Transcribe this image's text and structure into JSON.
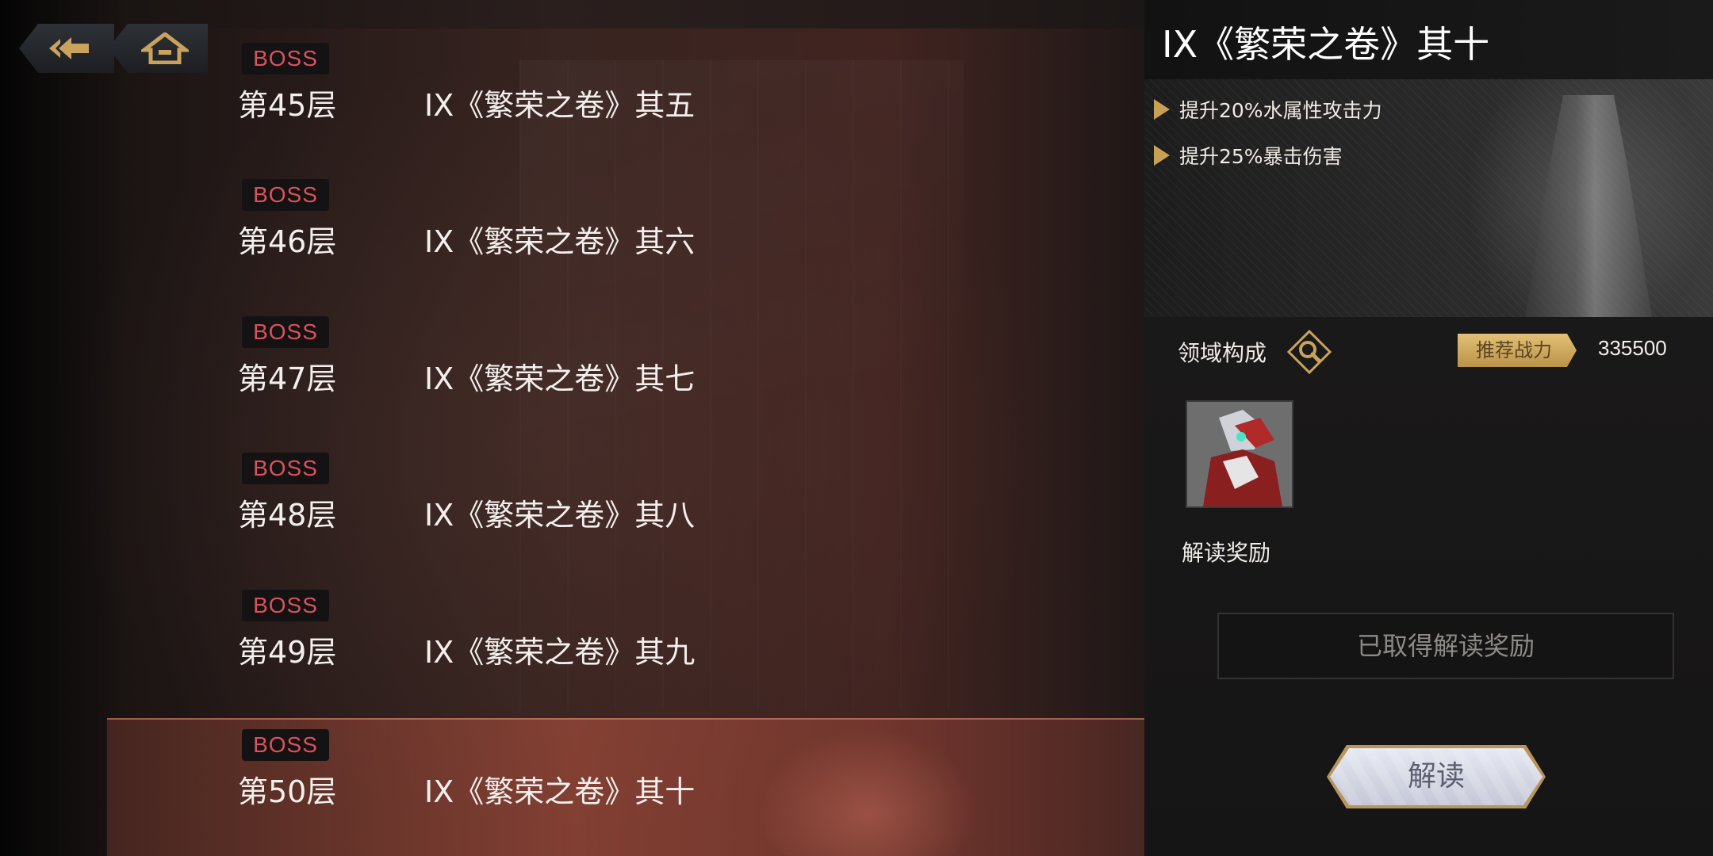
{
  "nav": {
    "back_icon": "back-arrow-icon",
    "home_icon": "home-icon"
  },
  "floors": [
    {
      "badge": "BOSS",
      "floor": "第45层",
      "name": "IX《繁荣之卷》其五"
    },
    {
      "badge": "BOSS",
      "floor": "第46层",
      "name": "IX《繁荣之卷》其六"
    },
    {
      "badge": "BOSS",
      "floor": "第47层",
      "name": "IX《繁荣之卷》其七"
    },
    {
      "badge": "BOSS",
      "floor": "第48层",
      "name": "IX《繁荣之卷》其八"
    },
    {
      "badge": "BOSS",
      "floor": "第49层",
      "name": "IX《繁荣之卷》其九"
    },
    {
      "badge": "BOSS",
      "floor": "第50层",
      "name": "IX《繁荣之卷》其十",
      "selected": true
    }
  ],
  "detail": {
    "title": "IX《繁荣之卷》其十",
    "buffs": [
      "提升20%水属性攻击力",
      "提升25%暴击伤害"
    ],
    "domain_label": "领域构成",
    "recommended_power_label": "推荐战力",
    "recommended_power_value": "335500",
    "reward_label": "解读奖励",
    "reward_status": "已取得解读奖励",
    "decode_button": "解读"
  },
  "colors": {
    "boss_red": "#d9525c",
    "gold_accent": "#c7a053"
  }
}
